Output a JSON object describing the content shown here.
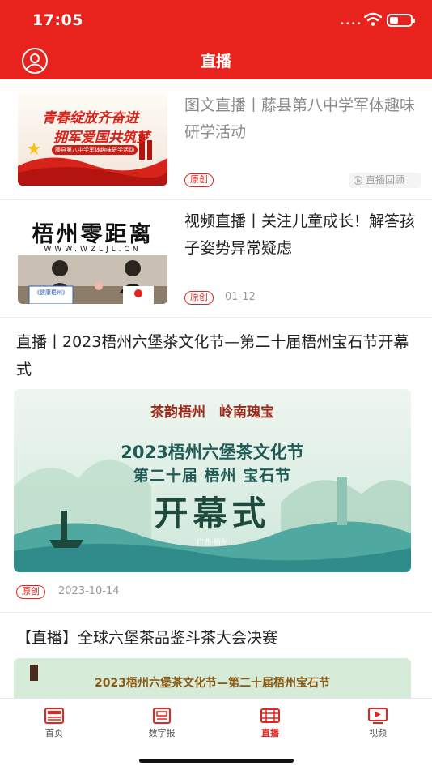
{
  "status_bar": {
    "time": "17:05",
    "signal_dots": "••••"
  },
  "header": {
    "title": "直播",
    "profile_icon": "user-circle-icon",
    "brand_color": "#e8231d"
  },
  "feed": [
    {
      "title": "图文直播丨藤县第八中学军体趣味研学活动",
      "tag": "原创",
      "status": "直播回顾",
      "thumbnail": {
        "line1": "青春绽放齐奋进",
        "line2": "拥军爱国共筑梦",
        "caption": "藤县第八中学军体趣味研学活动"
      }
    },
    {
      "title": "视频直播丨关注儿童成长！解答孩子姿势异常疑虑",
      "tag": "原创",
      "date": "01-12",
      "thumbnail": {
        "headline": "梧州零距离",
        "url": "WWW.WZLJL.CN",
        "desk_sign": "《健康梧州》"
      }
    },
    {
      "title": "直播丨2023梧州六堡茶文化节—第二十届梧州宝石节开幕式",
      "tag": "原创",
      "date": "2023-10-14",
      "banner": {
        "slogan": "茶韵梧州　岭南瑰宝",
        "line1": "2023梧州六堡茶文化节",
        "line2": "第二十届 梧州 宝石节",
        "big": "开幕式",
        "place": "广西·梧州"
      }
    },
    {
      "title": "【直播】全球六堡茶品鉴斗茶大会决赛",
      "banner": {
        "line": "2023梧州六堡茶文化节—第二十届梧州宝石节"
      }
    }
  ],
  "tabbar": {
    "tabs": [
      {
        "label": "首页",
        "icon": "newspaper-icon",
        "active": false
      },
      {
        "label": "数字报",
        "icon": "digital-paper-icon",
        "active": false
      },
      {
        "label": "直播",
        "icon": "live-film-icon",
        "active": true
      },
      {
        "label": "视频",
        "icon": "video-play-icon",
        "active": false
      }
    ]
  }
}
